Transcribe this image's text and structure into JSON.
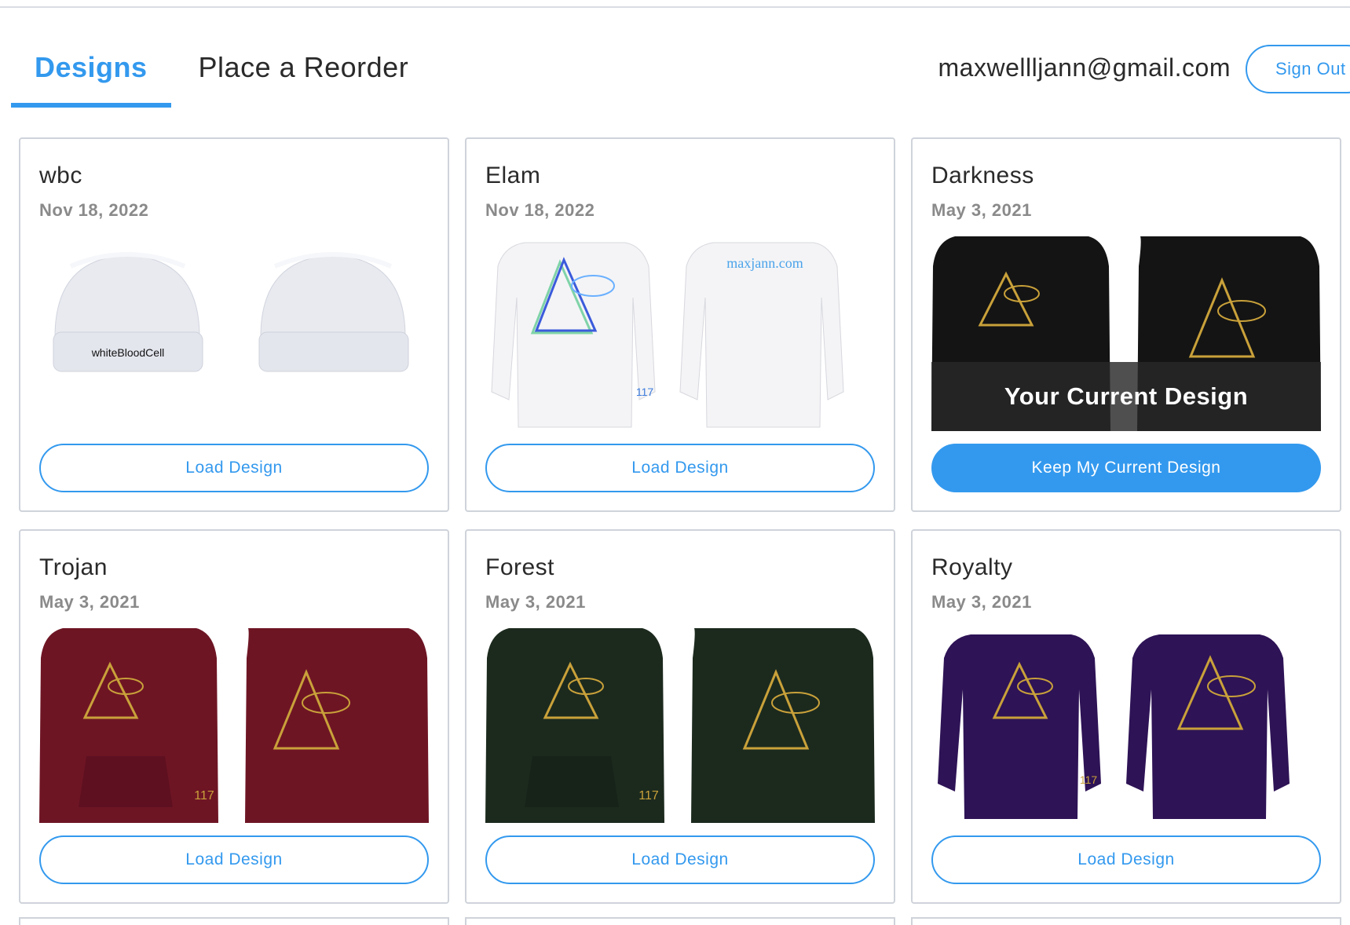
{
  "nav": {
    "tabs": [
      {
        "label": "Designs",
        "active": true
      },
      {
        "label": "Place a Reorder",
        "active": false
      }
    ],
    "email": "maxwellljann@gmail.com",
    "sign_out": "Sign Out"
  },
  "colors": {
    "accent": "#3399ee",
    "date": "#8a8a8a",
    "border": "#cfd3da"
  },
  "designs": [
    {
      "title": "wbc",
      "date": "Nov 18, 2022",
      "button": "Load Design",
      "product": "beanie",
      "garment_color": "#e8eaf0",
      "print_text": "whiteBloodCell"
    },
    {
      "title": "Elam",
      "date": "Nov 18, 2022",
      "button": "Load Design",
      "product": "long-sleeve",
      "garment_color": "#f4f4f6",
      "back_text": "maxjann.com",
      "sleeve_text": "117"
    },
    {
      "title": "Darkness",
      "date": "May 3, 2021",
      "button": "Keep My Current Design",
      "overlay": "Your Current Design",
      "product": "hoodie",
      "garment_color": "#141414",
      "current": true
    },
    {
      "title": "Trojan",
      "date": "May 3, 2021",
      "button": "Load Design",
      "product": "hoodie",
      "garment_color": "#6e1524",
      "sleeve_text": "117"
    },
    {
      "title": "Forest",
      "date": "May 3, 2021",
      "button": "Load Design",
      "product": "hoodie",
      "garment_color": "#1c2a1e",
      "sleeve_text": "117"
    },
    {
      "title": "Royalty",
      "date": "May 3, 2021",
      "button": "Load Design",
      "product": "long-sleeve",
      "garment_color": "#2e1356",
      "sleeve_text": "117"
    }
  ]
}
